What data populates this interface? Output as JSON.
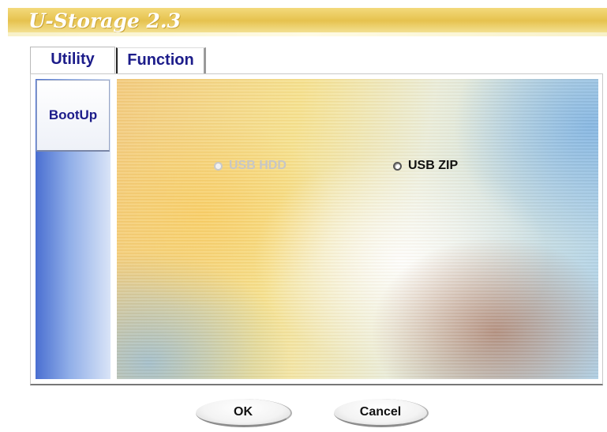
{
  "window": {
    "title": "U-Storage 2.3"
  },
  "tabs": [
    {
      "label": "Utility",
      "active": true
    },
    {
      "label": "Function",
      "active": false
    }
  ],
  "sidebar": {
    "items": [
      {
        "label": "BootUp",
        "selected": true
      }
    ]
  },
  "boot_options": [
    {
      "label": "USB HDD",
      "enabled": false,
      "selected": false
    },
    {
      "label": "USB ZIP",
      "enabled": true,
      "selected": false
    }
  ],
  "buttons": {
    "ok": "OK",
    "cancel": "Cancel"
  },
  "colors": {
    "title_bar": "#e6c24e",
    "tab_text": "#1c1c8a",
    "sidebar": "#4a6fd1"
  }
}
